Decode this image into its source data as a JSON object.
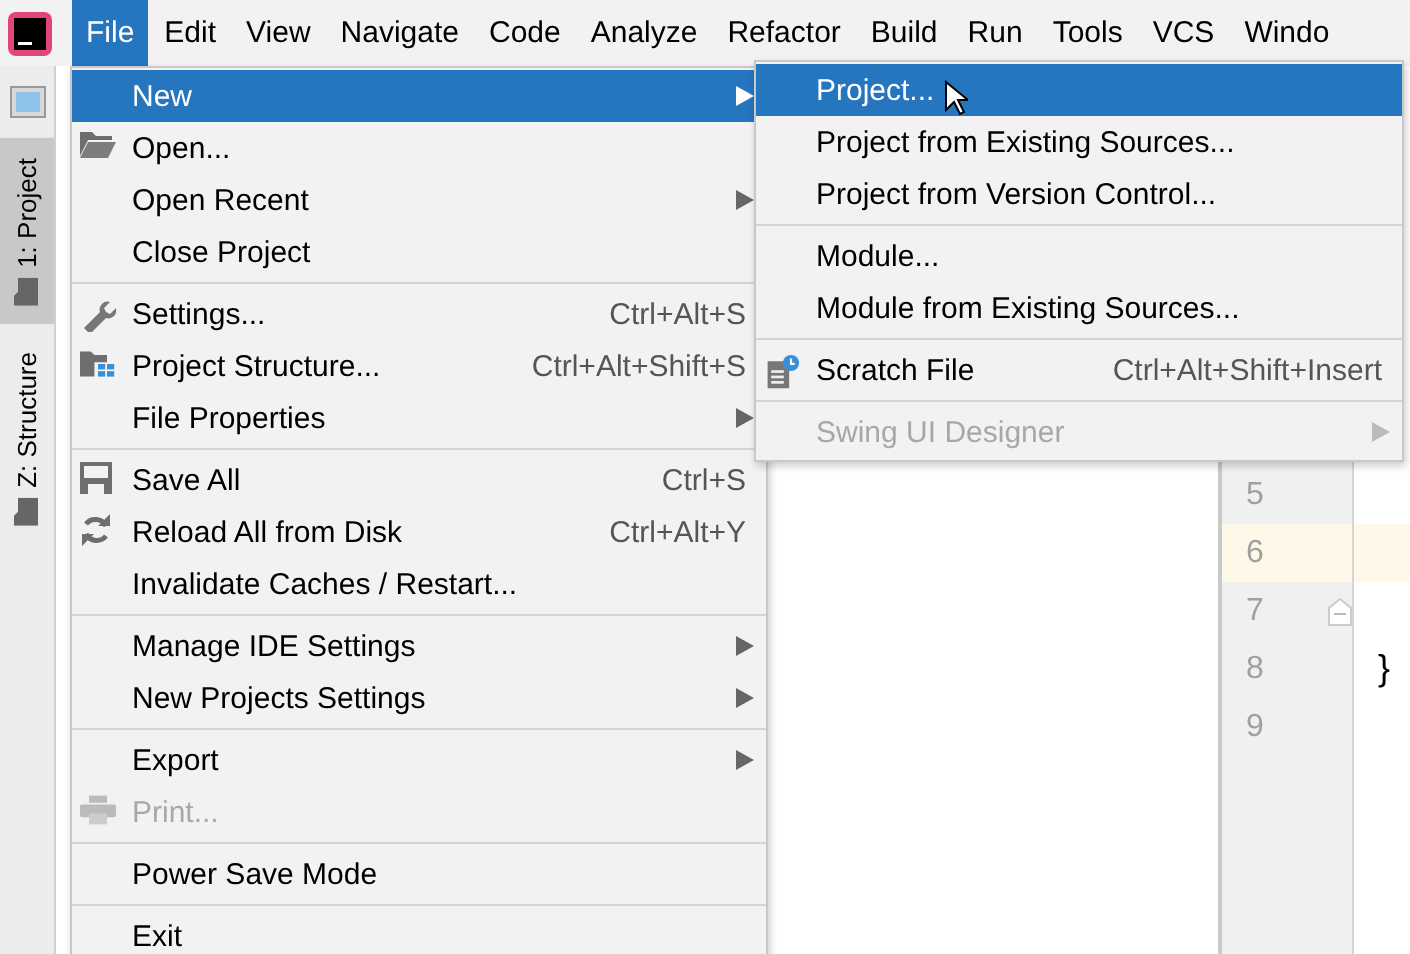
{
  "menubar": [
    {
      "label": "File",
      "selected": true
    },
    {
      "label": "Edit",
      "selected": false
    },
    {
      "label": "View",
      "selected": false
    },
    {
      "label": "Navigate",
      "selected": false
    },
    {
      "label": "Code",
      "selected": false
    },
    {
      "label": "Analyze",
      "selected": false
    },
    {
      "label": "Refactor",
      "selected": false
    },
    {
      "label": "Build",
      "selected": false
    },
    {
      "label": "Run",
      "selected": false
    },
    {
      "label": "Tools",
      "selected": false
    },
    {
      "label": "VCS",
      "selected": false
    },
    {
      "label": "Windo",
      "selected": false
    }
  ],
  "tool_window_tabs": [
    {
      "label": "1: Project",
      "selected": true
    },
    {
      "label": "Z: Structure",
      "selected": false
    }
  ],
  "file_menu": {
    "groups": [
      [
        {
          "label": "New",
          "submenu": true,
          "selected": true,
          "disabled": false
        },
        {
          "label": "Open...",
          "submenu": false,
          "selected": false,
          "disabled": false
        },
        {
          "label": "Open Recent",
          "submenu": true,
          "selected": false,
          "disabled": false
        },
        {
          "label": "Close Project",
          "submenu": false,
          "selected": false,
          "disabled": false
        }
      ],
      [
        {
          "label": "Settings...",
          "shortcut": "Ctrl+Alt+S",
          "submenu": false,
          "selected": false,
          "disabled": false
        },
        {
          "label": "Project Structure...",
          "shortcut": "Ctrl+Alt+Shift+S",
          "submenu": false,
          "selected": false,
          "disabled": false
        },
        {
          "label": "File Properties",
          "submenu": true,
          "selected": false,
          "disabled": false
        }
      ],
      [
        {
          "label": "Save All",
          "shortcut": "Ctrl+S",
          "submenu": false,
          "selected": false,
          "disabled": false
        },
        {
          "label": "Reload All from Disk",
          "shortcut": "Ctrl+Alt+Y",
          "submenu": false,
          "selected": false,
          "disabled": false
        },
        {
          "label": "Invalidate Caches / Restart...",
          "submenu": false,
          "selected": false,
          "disabled": false
        }
      ],
      [
        {
          "label": "Manage IDE Settings",
          "submenu": true,
          "selected": false,
          "disabled": false
        },
        {
          "label": "New Projects Settings",
          "submenu": true,
          "selected": false,
          "disabled": false
        }
      ],
      [
        {
          "label": "Export",
          "submenu": true,
          "selected": false,
          "disabled": false
        },
        {
          "label": "Print...",
          "submenu": false,
          "selected": false,
          "disabled": true
        }
      ],
      [
        {
          "label": "Power Save Mode",
          "submenu": false,
          "selected": false,
          "disabled": false
        }
      ],
      [
        {
          "label": "Exit",
          "submenu": false,
          "selected": false,
          "disabled": false
        }
      ]
    ]
  },
  "new_submenu": {
    "groups": [
      [
        {
          "label": "Project...",
          "submenu": false,
          "selected": true,
          "disabled": false
        },
        {
          "label": "Project from Existing Sources...",
          "submenu": false,
          "selected": false,
          "disabled": false
        },
        {
          "label": "Project from Version Control...",
          "submenu": false,
          "selected": false,
          "disabled": false
        }
      ],
      [
        {
          "label": "Module...",
          "submenu": false,
          "selected": false,
          "disabled": false
        },
        {
          "label": "Module from Existing Sources...",
          "submenu": false,
          "selected": false,
          "disabled": false
        }
      ],
      [
        {
          "label": "Scratch File",
          "shortcut": "Ctrl+Alt+Shift+Insert",
          "submenu": false,
          "selected": false,
          "disabled": false
        }
      ],
      [
        {
          "label": "Swing UI Designer",
          "submenu": true,
          "selected": false,
          "disabled": true
        }
      ]
    ]
  },
  "editor": {
    "lines": [
      {
        "number": "5",
        "current": false
      },
      {
        "number": "6",
        "current": true
      },
      {
        "number": "7",
        "current": false,
        "fold": true
      },
      {
        "number": "8",
        "current": false,
        "code": "}"
      },
      {
        "number": "9",
        "current": false
      }
    ]
  }
}
